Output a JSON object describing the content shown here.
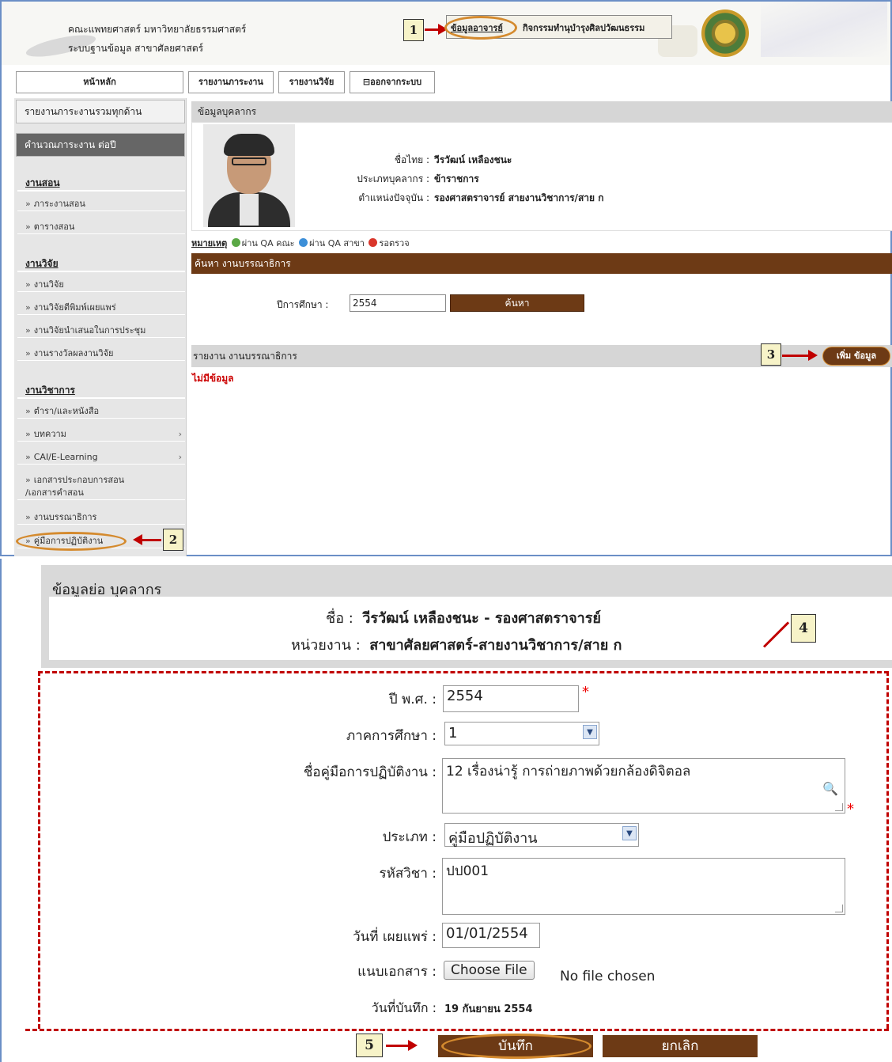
{
  "header": {
    "faculty": "คณะแพทยศาสตร์ มหาวิทยาลัยธรรมศาสตร์",
    "system": "ระบบฐานข้อมูล สาขาศัลยศาสตร์",
    "menu_teacher": "ข้อมูลอาจารย์",
    "menu_culture": "กิจกรรมทำนุบำรุงศิลปวัฒนธรรม"
  },
  "nav": {
    "home": "หน้าหลัก",
    "workload": "รายงานภาระงาน",
    "research": "รายงานวิจัย",
    "logout": "ออกจากระบบ"
  },
  "sidebar": {
    "all_report": "รายงานภาระงานรวมทุกด้าน",
    "calc": "คำนวณภาระงาน ต่อปี",
    "teach_head": "งานสอน",
    "teach_items": [
      "ภาระงานสอน",
      "ตารางสอน"
    ],
    "research_head": "งานวิจัย",
    "research_items": [
      "งานวิจัย",
      "งานวิจัยตีพิมพ์เผยแพร่",
      "งานวิจัยนำเสนอในการประชุม",
      "งานรางวัลผลงานวิจัย"
    ],
    "academic_head": "งานวิชาการ",
    "academic_items": [
      "ตำรา/และหนังสือ",
      "บทความ",
      "CAI/E-Learning",
      "เอกสารประกอบการสอน",
      "/เอกสารคำสอน",
      "งานบรรณาธิการ",
      "คู่มือการปฏิบัติงาน"
    ]
  },
  "profile": {
    "section": "ข้อมูลบุคลากร",
    "name_label": "ชื่อไทย :",
    "name_value": "วีรวัฒน์ เหลืองชนะ",
    "type_label": "ประเภทบุคลากร :",
    "type_value": "ข้าราชการ",
    "pos_label": "ตำแหน่งปัจจุบัน :",
    "pos_value": "รองศาสตราจารย์ สายงานวิชาการ/สาย ก"
  },
  "legend": {
    "title": "หมายเหตุ",
    "pass_faculty": "ผ่าน QA คณะ",
    "pass_branch": "ผ่าน QA สาขา",
    "pending": "รอตรวจ",
    "colors": {
      "faculty": "#5aa845",
      "branch": "#3c8fd8",
      "pending": "#d9362b"
    }
  },
  "search": {
    "bar": "ค้นหา งานบรรณาธิการ",
    "year_label": "ปีการศึกษา :",
    "year_value": "2554",
    "button": "ค้นหา"
  },
  "report": {
    "bar": "รายงาน งานบรรณาธิการ",
    "add_button": "เพิ่ม ข้อมูล",
    "no_data": "ไม่มีข้อมูล"
  },
  "callouts": {
    "n1": "1",
    "n2": "2",
    "n3": "3",
    "n4": "4",
    "n5": "5"
  },
  "form": {
    "title": "ข้อมูลย่อ บุคลากร",
    "name_label": "ชื่อ :",
    "name_value": "วีรวัฒน์ เหลืองชนะ - รองศาสตราจารย์",
    "unit_label": "หน่วยงาน :",
    "unit_value": "สาขาศัลยศาสตร์-สายงานวิชาการ/สาย ก",
    "year_label": "ปี พ.ศ. :",
    "year_value": "2554",
    "term_label": "ภาคการศึกษา :",
    "term_value": "1",
    "manual_label": "ชื่อคู่มือการปฏิบัติงาน :",
    "manual_value": "12  เรื่องน่ารู้  การถ่ายภาพด้วยกล้องดิจิตอล",
    "type_label": "ประเภท :",
    "type_value": "คู่มือปฏิบัติงาน",
    "code_label": "รหัสวิชา :",
    "code_value": "ปป001",
    "date_label": "วันที่ เผยแพร่ :",
    "date_value": "01/01/2554",
    "attach_label": "แนบเอกสาร  :",
    "choose_file": "Choose File",
    "no_file": "No file chosen",
    "saved_label": "วันที่บันทึก  :",
    "saved_value": "19 กันยายน 2554",
    "required_mark": "*",
    "save_button": "บันทึก",
    "cancel_button": "ยกเลิก"
  }
}
